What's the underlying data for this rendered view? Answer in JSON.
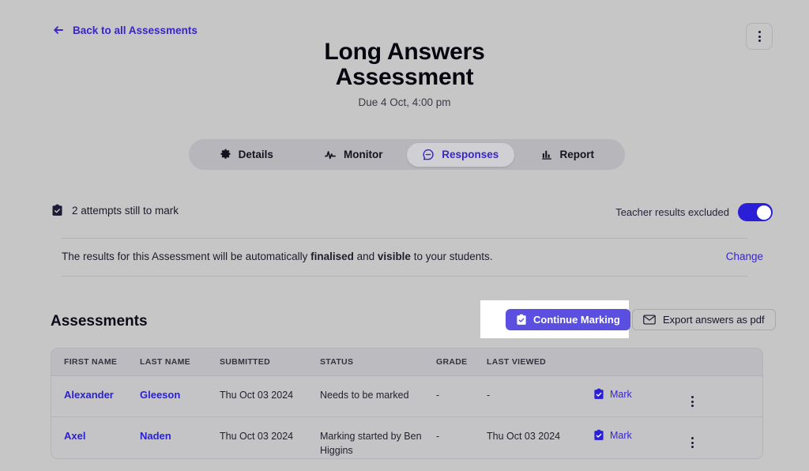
{
  "header": {
    "back_label": "Back to all Assessments",
    "back_icon": "arrow-left-icon",
    "menu_icon": "kebab-menu-icon",
    "title_line1": "Long Answers",
    "title_line2": "Assessment",
    "due": "Due 4 Oct, 4:00 pm"
  },
  "tabs": [
    {
      "label": "Details",
      "icon": "gear-icon",
      "active": false
    },
    {
      "label": "Monitor",
      "icon": "activity-pulse-icon",
      "active": false
    },
    {
      "label": "Responses",
      "icon": "speech-bubble-icon",
      "active": true
    },
    {
      "label": "Report",
      "icon": "bar-chart-icon",
      "active": false
    }
  ],
  "status_bar": {
    "attempts_icon": "clipboard-check-icon",
    "attempts_text": "2 attempts still to mark",
    "toggle_label": "Teacher results excluded",
    "toggle_on": true
  },
  "notice": {
    "text_part1": "The results for this Assessment will be automatically ",
    "bold1": "finalised",
    "text_part2": " and ",
    "bold2": "visible",
    "text_part3": " to your students.",
    "change_label": "Change"
  },
  "section": {
    "title": "Assessments",
    "continue_marking_label": "Continue Marking",
    "continue_marking_icon": "clipboard-check-icon",
    "export_label": "Export answers as pdf",
    "export_icon": "envelope-icon"
  },
  "table": {
    "columns": [
      "FIRST NAME",
      "LAST NAME",
      "SUBMITTED",
      "STATUS",
      "GRADE",
      "LAST VIEWED",
      "",
      ""
    ],
    "rows": [
      {
        "first_name": "Alexander",
        "last_name": "Gleeson",
        "submitted": "Thu Oct 03 2024",
        "status": "Needs to be marked",
        "grade": "-",
        "last_viewed": "-",
        "action_label": "Mark",
        "action_icon": "clipboard-check-icon",
        "row_menu_icon": "kebab-menu-icon"
      },
      {
        "first_name": "Axel",
        "last_name": "Naden",
        "submitted": "Thu Oct 03 2024",
        "status": "Marking started by Ben Higgins",
        "grade": "-",
        "last_viewed": "Thu Oct 03 2024",
        "action_label": "Mark",
        "action_icon": "clipboard-check-icon",
        "row_menu_icon": "kebab-menu-icon"
      }
    ]
  },
  "colors": {
    "page_bg": "#c6c6c6",
    "accent": "#3826c8",
    "primary_button": "#5a4fe0",
    "toggle_on": "#2a1fd6",
    "highlight_box": "#ffffff"
  }
}
